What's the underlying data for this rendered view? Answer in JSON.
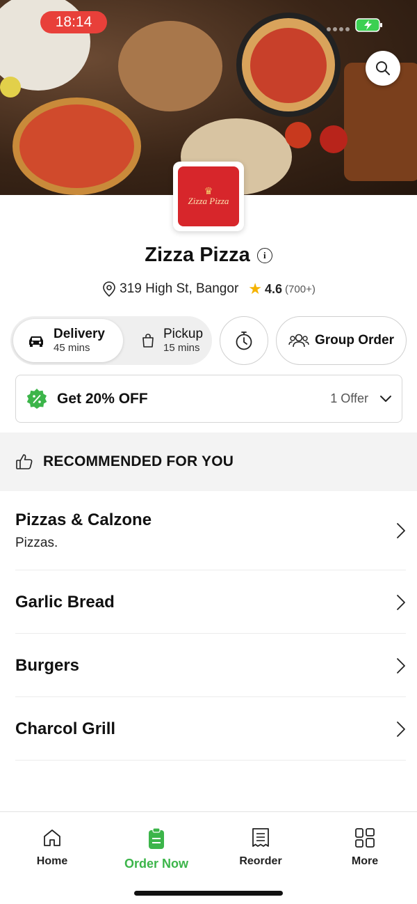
{
  "status_bar": {
    "time": "18:14"
  },
  "restaurant": {
    "name": "Zizza Pizza",
    "logo_text": "Zizza Pizza",
    "address": "319 High St, Bangor",
    "rating": "4.6",
    "rating_count": "(700+)"
  },
  "order_modes": {
    "delivery": {
      "label": "Delivery",
      "time": "45 mins"
    },
    "pickup": {
      "label": "Pickup",
      "time": "15 mins"
    },
    "group_order_label": "Group Order"
  },
  "offer": {
    "title": "Get 20% OFF",
    "count": "1 Offer"
  },
  "recommended": {
    "title": "RECOMMENDED FOR YOU"
  },
  "categories": [
    {
      "name": "Pizzas & Calzone",
      "description": "Pizzas."
    },
    {
      "name": "Garlic Bread"
    },
    {
      "name": "Burgers"
    },
    {
      "name": "Charcol Grill"
    }
  ],
  "bottom_nav": [
    {
      "label": "Home",
      "icon": "home-icon"
    },
    {
      "label": "Order Now",
      "icon": "order-icon",
      "active": true
    },
    {
      "label": "Reorder",
      "icon": "receipt-icon"
    },
    {
      "label": "More",
      "icon": "grid-icon"
    }
  ],
  "colors": {
    "accent_green": "#3cb54a",
    "brand_red": "#d7262b",
    "star": "#f5b301",
    "time_pill": "#e8403a"
  }
}
